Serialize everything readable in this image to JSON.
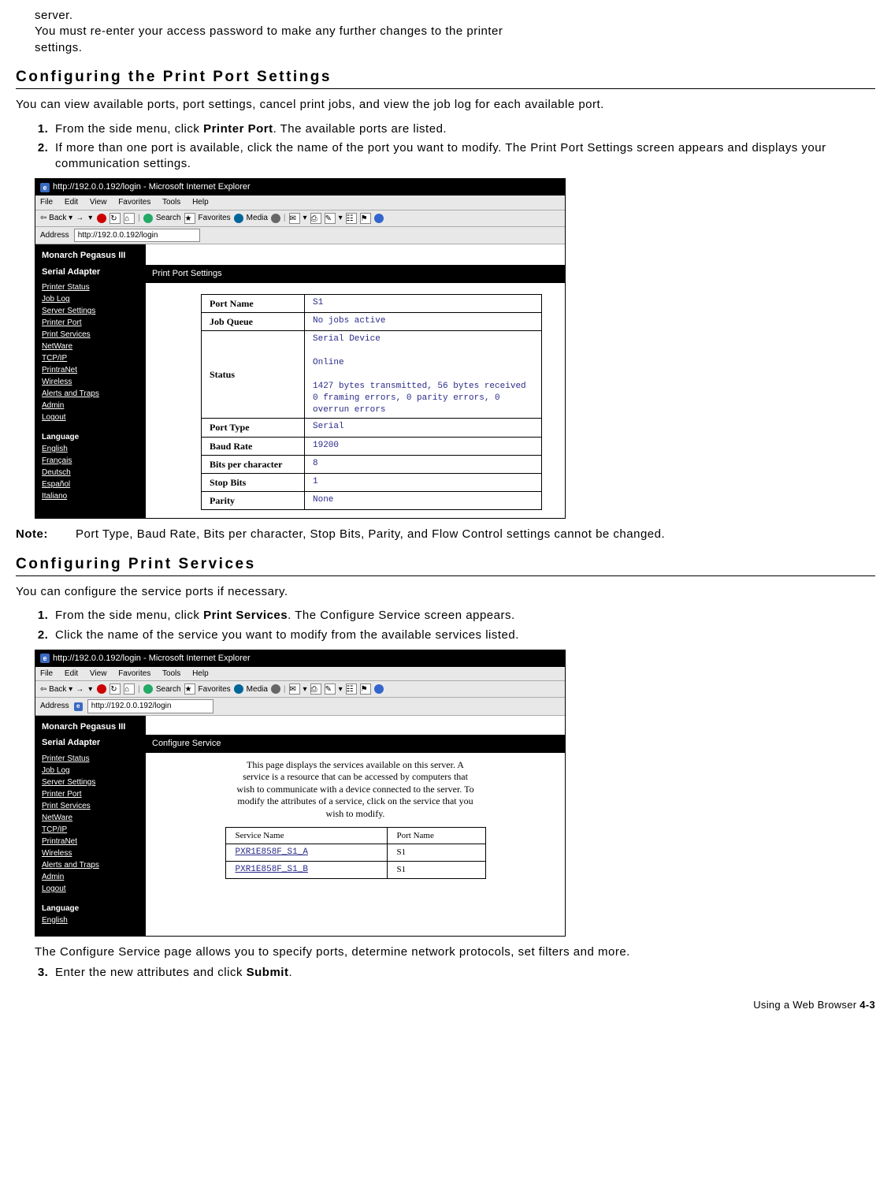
{
  "intro": {
    "line1": "server.",
    "line2a": "You must re-enter your access password to make any further changes to the printer",
    "line2b": "settings."
  },
  "section1": {
    "title": "Configuring the Print Port Settings",
    "p1": "You can view available ports, port settings, cancel print jobs, and view the job log for each available port.",
    "step1a": "From the side menu, click ",
    "step1b": "Printer Port",
    "step1c": ".  The available ports are listed.",
    "step2": "If more than one port is available, click the name of the port you want to modify. The Print Port Settings screen appears and displays your communication settings."
  },
  "browser": {
    "title": "http://192.0.0.192/login - Microsoft Internet Explorer",
    "menu": {
      "file": "File",
      "edit": "Edit",
      "view": "View",
      "fav": "Favorites",
      "tools": "Tools",
      "help": "Help"
    },
    "toolbar": {
      "back": "Back",
      "search": "Search",
      "favorites": "Favorites",
      "media": "Media"
    },
    "addressLabel": "Address",
    "url": "http://192.0.0.192/login"
  },
  "sidebar": {
    "title1": "Monarch Pegasus III",
    "title2": "Serial Adapter",
    "links": [
      "Printer Status",
      "Job Log",
      "Server Settings",
      "Printer Port",
      "Print Services",
      "NetWare",
      "TCP/IP",
      "PrintraNet",
      "Wireless",
      "Alerts and Traps",
      "Admin",
      "Logout"
    ],
    "langHeader": "Language",
    "langs": [
      "English",
      "Français",
      "Deutsch",
      "Español",
      "Italiano"
    ]
  },
  "portPanel": {
    "header": "Print Port Settings",
    "rows": {
      "portName": {
        "label": "Port Name",
        "value": "S1"
      },
      "jobQueue": {
        "label": "Job Queue",
        "value": "No jobs active"
      },
      "status": {
        "label": "Status",
        "l1": "Serial Device",
        "l2": "Online",
        "l3": "1427 bytes transmitted, 56 bytes received",
        "l4": "0 framing errors, 0 parity errors, 0 overrun errors"
      },
      "portType": {
        "label": "Port Type",
        "value": "Serial"
      },
      "baud": {
        "label": "Baud Rate",
        "value": "19200"
      },
      "bits": {
        "label": "Bits per character",
        "value": "8"
      },
      "stop": {
        "label": "Stop Bits",
        "value": "1"
      },
      "parity": {
        "label": "Parity",
        "value": "None"
      }
    }
  },
  "note": {
    "label": "Note:",
    "text": "Port Type, Baud Rate, Bits per character, Stop Bits, Parity, and Flow Control settings cannot be changed."
  },
  "section2": {
    "title": "Configuring Print Services",
    "p1": "You can configure the service ports if necessary.",
    "step1a": "From the side menu, click ",
    "step1b": "Print Services",
    "step1c": ". The Configure Service screen appears.",
    "step2": "Click the name of the service you want to modify from the available services listed."
  },
  "svcPanel": {
    "header": "Configure Service",
    "desc": "This page displays the services available on this server. A service is a resource that can be accessed by computers that wish to communicate with a device connected to the server. To modify the attributes of a service, click on the service that you wish to modify.",
    "col1": "Service Name",
    "col2": "Port Name",
    "r1": {
      "name": "PXR1E858F_S1_A",
      "port": "S1"
    },
    "r2": {
      "name": "PXR1E858F_S1_B",
      "port": "S1"
    }
  },
  "afterImg2": "The Configure Service page allows you to specify ports, determine network protocols, set filters and more.",
  "step3a": "Enter the new attributes and click ",
  "step3b": "Submit",
  "step3c": ".",
  "footer": {
    "text": "Using a Web Browser  ",
    "page": "4-3"
  }
}
